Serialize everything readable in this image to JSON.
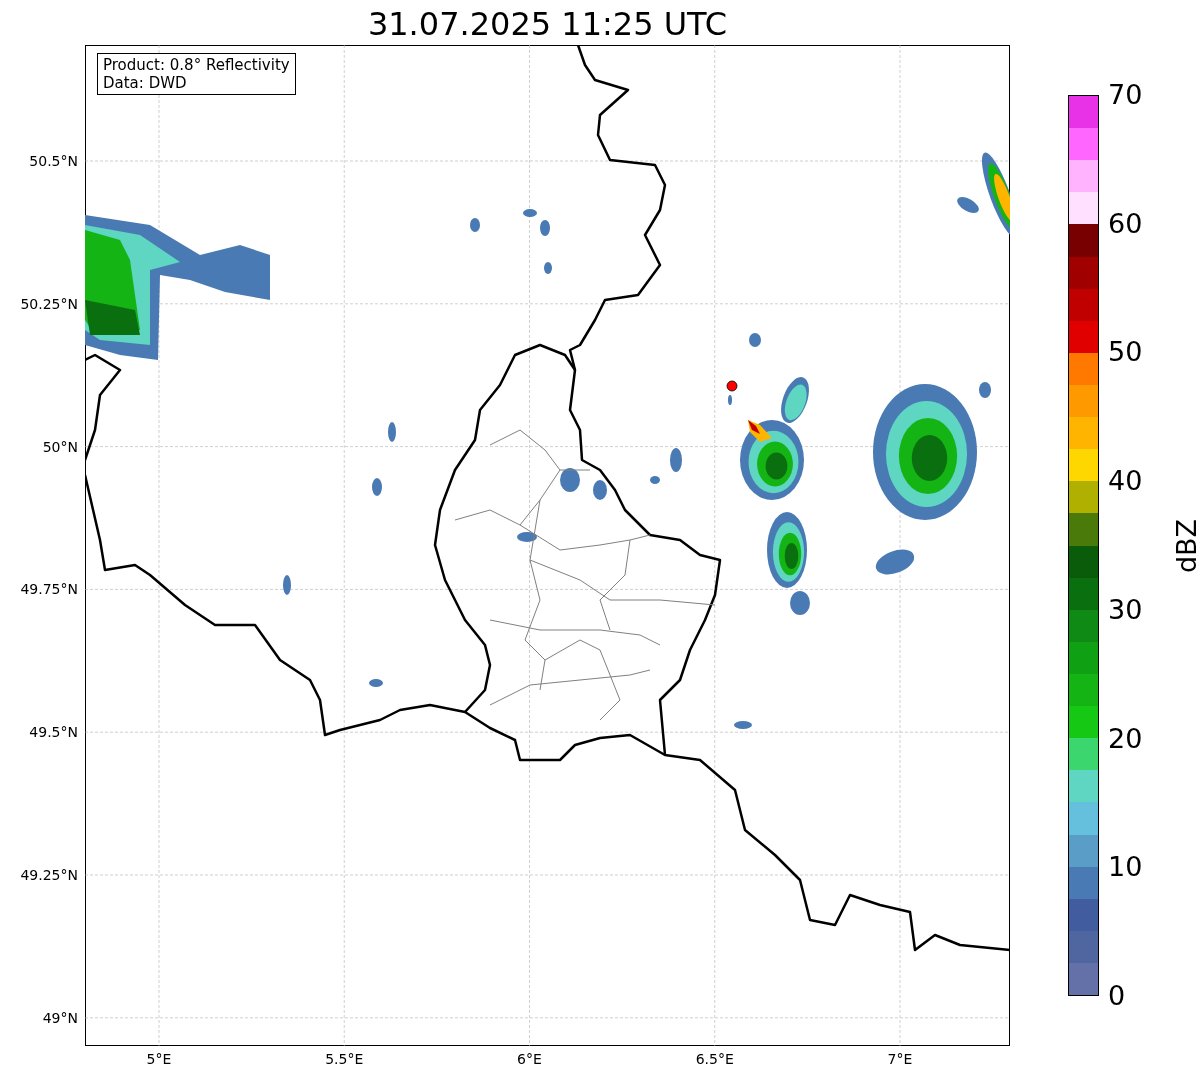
{
  "title": "31.07.2025 11:25 UTC",
  "legend": [
    "Product: 0.8° Reflectivity",
    "Data: DWD"
  ],
  "map": {
    "x_ticks": [
      "5°E",
      "5.5°E",
      "6°E",
      "6.5°E",
      "7°E"
    ],
    "y_ticks": [
      "50.5°N",
      "50.25°N",
      "50°N",
      "49.75°N",
      "49.5°N",
      "49.25°N",
      "49°N"
    ]
  },
  "colorbar": {
    "label": "dBZ",
    "ticks": [
      "70",
      "60",
      "50",
      "40",
      "30",
      "20",
      "10",
      "0"
    ],
    "bins": [
      {
        "color": "#e832e8"
      },
      {
        "color": "#ff66ff"
      },
      {
        "color": "#ffb3ff"
      },
      {
        "color": "#ffe0ff"
      },
      {
        "color": "#780000"
      },
      {
        "color": "#a00000"
      },
      {
        "color": "#c00000"
      },
      {
        "color": "#e00000"
      },
      {
        "color": "#ff7800"
      },
      {
        "color": "#ff9900"
      },
      {
        "color": "#ffb400"
      },
      {
        "color": "#ffd700"
      },
      {
        "color": "#b0b000"
      },
      {
        "color": "#4a7a0a"
      },
      {
        "color": "#0a5c0a"
      },
      {
        "color": "#0a700f"
      },
      {
        "color": "#0f8a14"
      },
      {
        "color": "#0fa014"
      },
      {
        "color": "#14b414"
      },
      {
        "color": "#14c814"
      },
      {
        "color": "#3cd66e"
      },
      {
        "color": "#5ed6c2"
      },
      {
        "color": "#64c0dc"
      },
      {
        "color": "#5a9ec8"
      },
      {
        "color": "#4a7ab4"
      },
      {
        "color": "#425ca0"
      },
      {
        "color": "#5066a0"
      },
      {
        "color": "#6470a8"
      }
    ]
  }
}
